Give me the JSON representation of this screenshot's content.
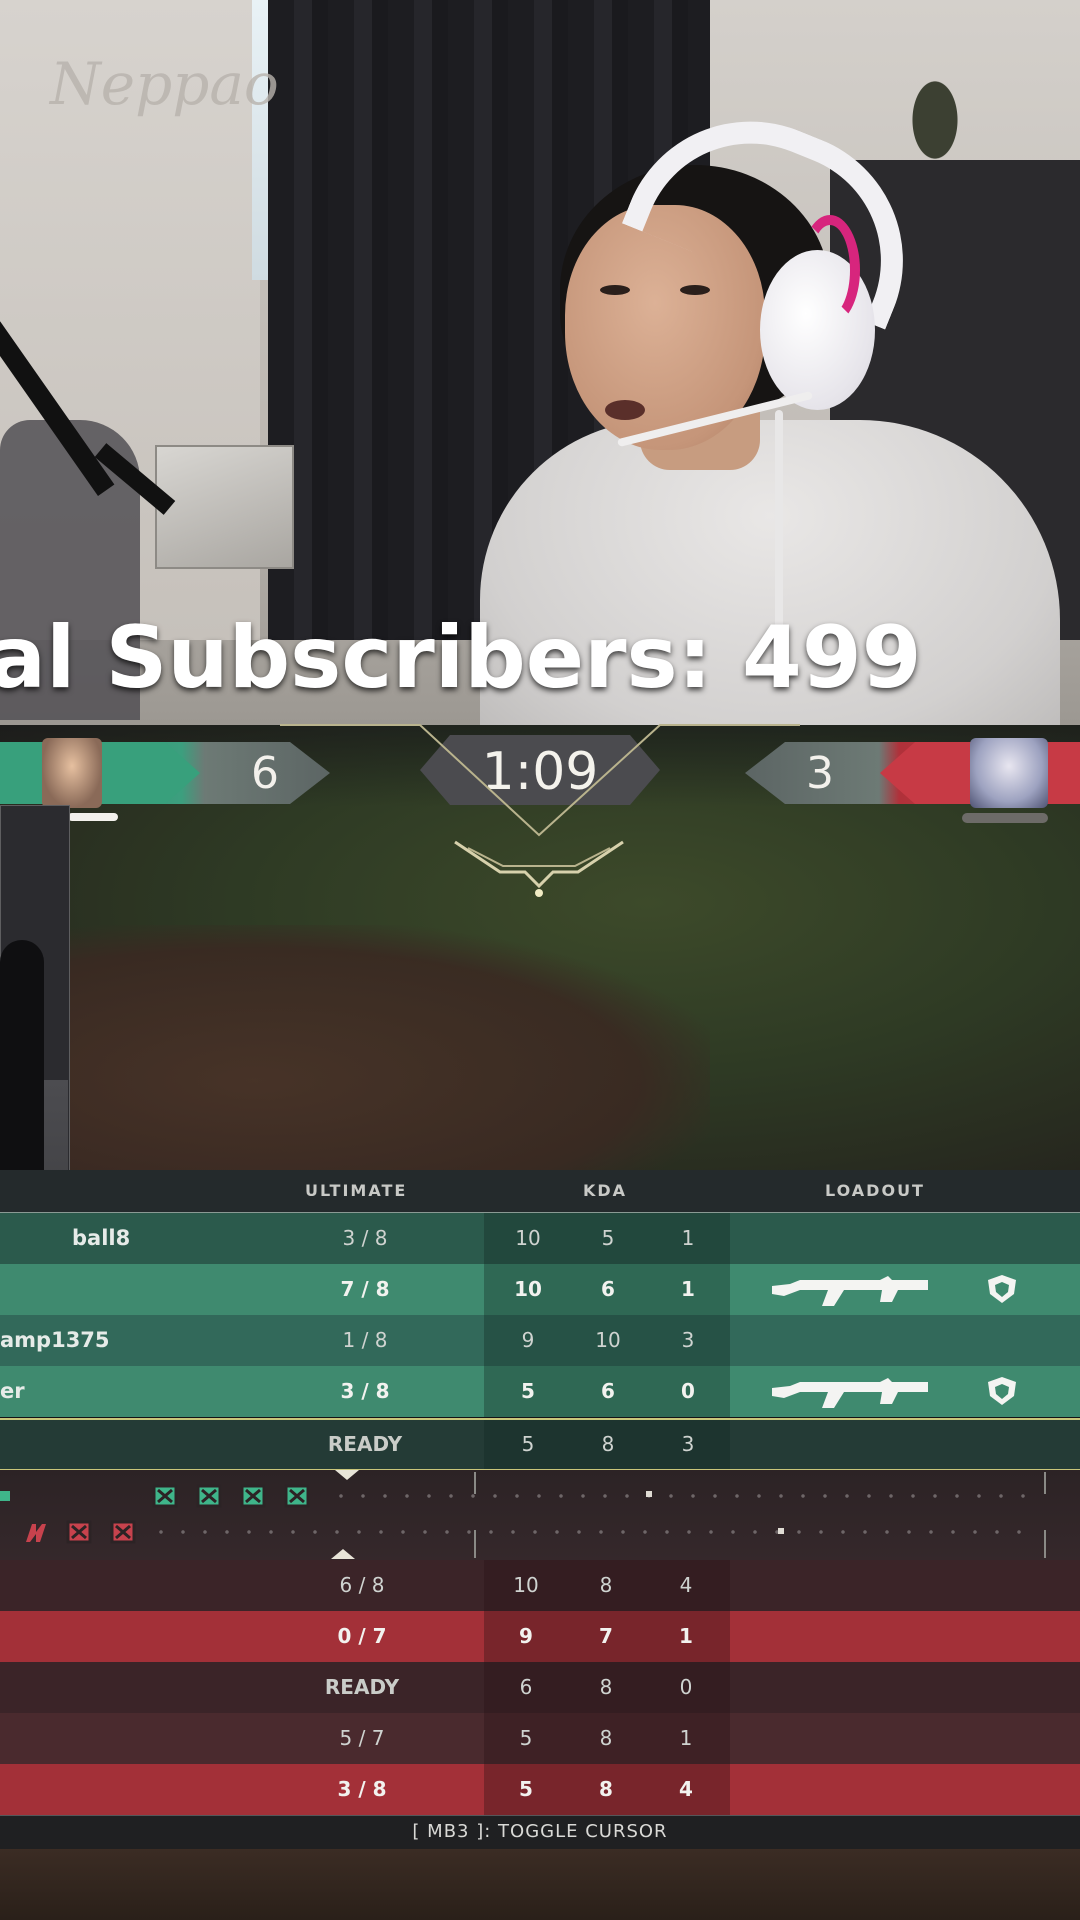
{
  "overlay": {
    "subscriber_text": "al Subscribers: 499",
    "wall_sign": "Neppao"
  },
  "hud": {
    "left_score": "6",
    "timer": "1:09",
    "right_score": "3",
    "colors": {
      "ally": "#38a07c",
      "enemy": "#c73a45"
    }
  },
  "scoreboard": {
    "headers": {
      "ultimate": "ULTIMATE",
      "kda": "KDA",
      "loadout": "LOADOUT"
    },
    "ally_rows": [
      {
        "name": "ball8",
        "ult": "3 / 8",
        "k": "10",
        "d": "5",
        "a": "1",
        "weapon": false
      },
      {
        "name": "",
        "ult": "7 / 8",
        "k": "10",
        "d": "6",
        "a": "1",
        "weapon": true
      },
      {
        "name": "amp1375",
        "ult": "1 / 8",
        "k": "9",
        "d": "10",
        "a": "3",
        "weapon": false
      },
      {
        "name": "er",
        "ult": "3 / 8",
        "k": "5",
        "d": "6",
        "a": "0",
        "weapon": true
      },
      {
        "name": "",
        "ult": "READY",
        "k": "5",
        "d": "8",
        "a": "3",
        "weapon": false
      }
    ],
    "enemy_rows": [
      {
        "ult": "6 / 8",
        "k": "10",
        "d": "8",
        "a": "4"
      },
      {
        "ult": "0 / 7",
        "k": "9",
        "d": "7",
        "a": "1"
      },
      {
        "ult": "READY",
        "k": "6",
        "d": "8",
        "a": "0"
      },
      {
        "ult": "5 / 7",
        "k": "5",
        "d": "8",
        "a": "1"
      },
      {
        "ult": "3 / 8",
        "k": "5",
        "d": "8",
        "a": "4"
      }
    ],
    "footer": "[ MB3 ]: TOGGLE CURSOR"
  }
}
